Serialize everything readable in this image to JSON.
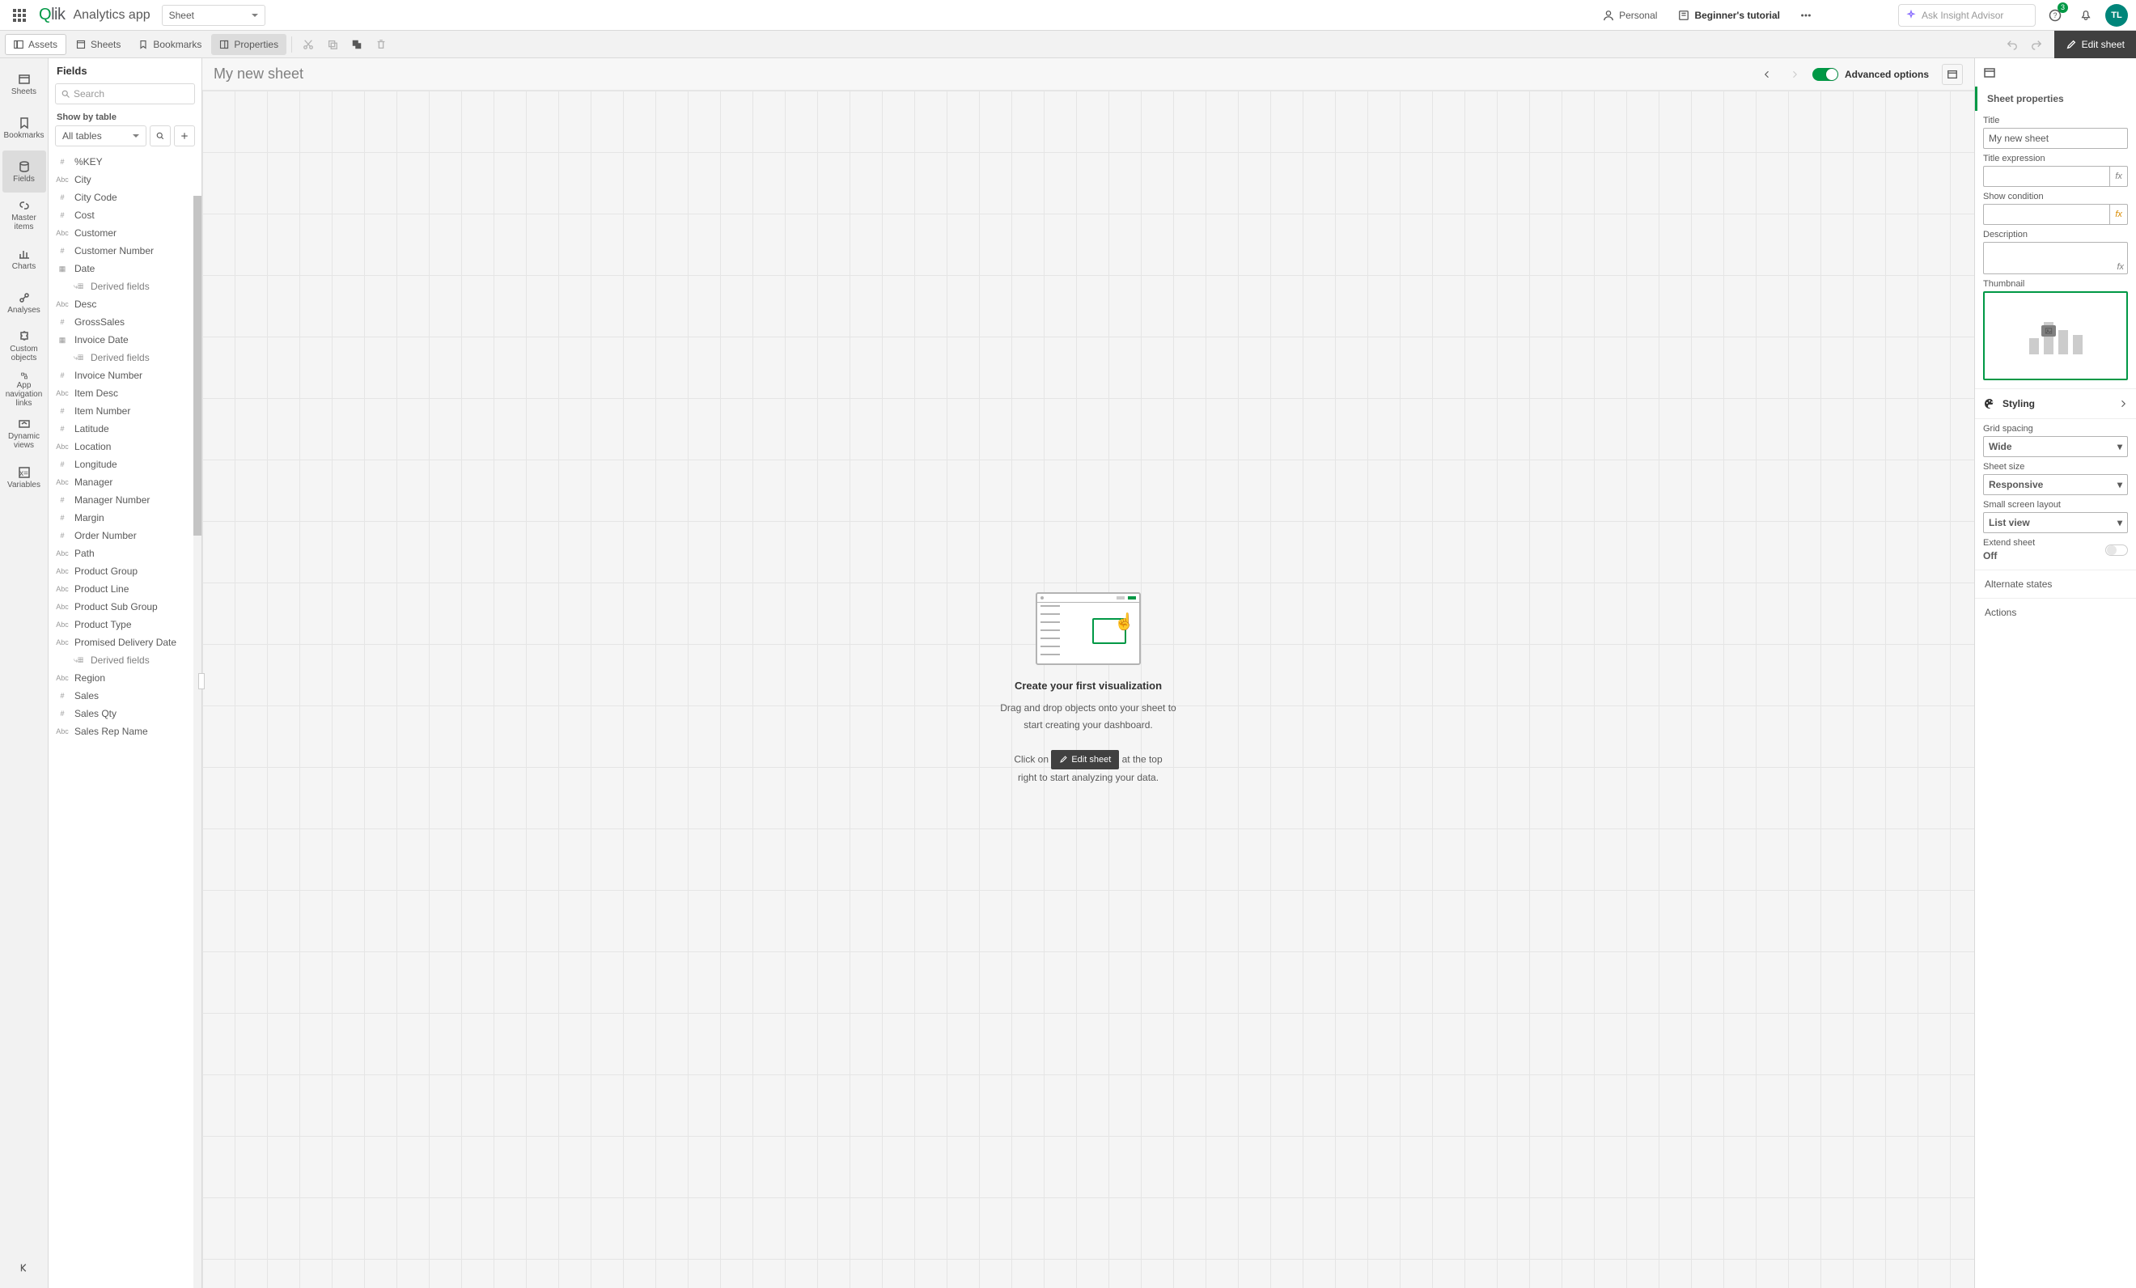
{
  "topbar": {
    "app_name": "Analytics app",
    "sheet_dropdown_label": "Sheet",
    "personal_label": "Personal",
    "tutorial_label": "Beginner's tutorial",
    "insight_placeholder": "Ask Insight Advisor",
    "notification_badge": "3",
    "avatar_text": "TL"
  },
  "toolbar": {
    "assets_label": "Assets",
    "sheets_label": "Sheets",
    "bookmarks_label": "Bookmarks",
    "properties_label": "Properties",
    "edit_sheet_label": "Edit sheet"
  },
  "rail": [
    {
      "key": "sheets",
      "label": "Sheets"
    },
    {
      "key": "bookmarks",
      "label": "Bookmarks"
    },
    {
      "key": "fields",
      "label": "Fields"
    },
    {
      "key": "master",
      "label": "Master items"
    },
    {
      "key": "charts",
      "label": "Charts"
    },
    {
      "key": "analyses",
      "label": "Analyses"
    },
    {
      "key": "custom",
      "label": "Custom objects"
    },
    {
      "key": "nav",
      "label": "App navigation links"
    },
    {
      "key": "dynamic",
      "label": "Dynamic views"
    },
    {
      "key": "variables",
      "label": "Variables"
    }
  ],
  "fields_panel": {
    "header": "Fields",
    "search_placeholder": "Search",
    "show_by_table": "Show by table",
    "tables_select": "All tables",
    "list": [
      {
        "type": "#",
        "name": "%KEY"
      },
      {
        "type": "Abc",
        "name": "City"
      },
      {
        "type": "#",
        "name": "City Code"
      },
      {
        "type": "#",
        "name": "Cost"
      },
      {
        "type": "Abc",
        "name": "Customer"
      },
      {
        "type": "#",
        "name": "Customer Number"
      },
      {
        "type": "date",
        "name": "Date"
      },
      {
        "type": "derived",
        "name": "Derived fields"
      },
      {
        "type": "Abc",
        "name": "Desc"
      },
      {
        "type": "#",
        "name": "GrossSales"
      },
      {
        "type": "date",
        "name": "Invoice Date"
      },
      {
        "type": "derived",
        "name": "Derived fields"
      },
      {
        "type": "#",
        "name": "Invoice Number"
      },
      {
        "type": "Abc",
        "name": "Item Desc"
      },
      {
        "type": "#",
        "name": "Item Number"
      },
      {
        "type": "#",
        "name": "Latitude"
      },
      {
        "type": "Abc",
        "name": "Location"
      },
      {
        "type": "#",
        "name": "Longitude"
      },
      {
        "type": "Abc",
        "name": "Manager"
      },
      {
        "type": "#",
        "name": "Manager Number"
      },
      {
        "type": "#",
        "name": "Margin"
      },
      {
        "type": "#",
        "name": "Order Number"
      },
      {
        "type": "Abc",
        "name": "Path"
      },
      {
        "type": "Abc",
        "name": "Product Group"
      },
      {
        "type": "Abc",
        "name": "Product Line"
      },
      {
        "type": "Abc",
        "name": "Product Sub Group"
      },
      {
        "type": "Abc",
        "name": "Product Type"
      },
      {
        "type": "Abc",
        "name": "Promised Delivery Date"
      },
      {
        "type": "derived",
        "name": "Derived fields"
      },
      {
        "type": "Abc",
        "name": "Region"
      },
      {
        "type": "#",
        "name": "Sales"
      },
      {
        "type": "#",
        "name": "Sales Qty"
      },
      {
        "type": "Abc",
        "name": "Sales Rep Name"
      }
    ]
  },
  "canvas": {
    "sheet_title": "My new sheet",
    "advanced_label": "Advanced options",
    "placeholder_title": "Create your first visualization",
    "placeholder_line1": "Drag and drop objects onto your sheet to",
    "placeholder_line2": "start creating your dashboard.",
    "placeholder_click_on": "Click on ",
    "placeholder_chip": "Edit sheet",
    "placeholder_line3_tail": " at the top",
    "placeholder_line4": "right to start analyzing your data."
  },
  "props": {
    "section_header": "Sheet properties",
    "title_label": "Title",
    "title_value": "My new sheet",
    "title_expr_label": "Title expression",
    "show_cond_label": "Show condition",
    "description_label": "Description",
    "thumb_label": "Thumbnail",
    "styling_label": "Styling",
    "grid_spacing_label": "Grid spacing",
    "grid_spacing_value": "Wide",
    "sheet_size_label": "Sheet size",
    "sheet_size_value": "Responsive",
    "small_screen_label": "Small screen layout",
    "small_screen_value": "List view",
    "extend_sheet_label": "Extend sheet",
    "extend_sheet_value": "Off",
    "alt_states_label": "Alternate states",
    "actions_label": "Actions"
  }
}
